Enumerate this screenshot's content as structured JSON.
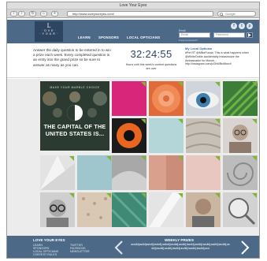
{
  "browser": {
    "window_title": "Love Your Eyes",
    "url": "http://www.loveyoureyes.com/",
    "search_placeholder": "Google",
    "back_glyph": "‹",
    "forward_glyph": "›",
    "reload_glyph": "↻",
    "home_glyph": "⌂",
    "add_glyph": "+"
  },
  "header": {
    "logo_line1": "L",
    "logo_line2": "· O V E ·",
    "logo_line3": "· Y O U R ·",
    "nav": [
      "LEARN",
      "SPONSORS",
      "LOCAL OPTICIANS"
    ],
    "login_email_label": "Email",
    "login_password_label": "Password",
    "email_placeholder": "Email",
    "password_placeholder": "Password",
    "forgot_link": "Forgot password?",
    "social_icons": [
      "facebook-icon",
      "twitter-icon",
      "pinterest-icon"
    ],
    "social_glyphs": [
      "f",
      "t",
      "p"
    ]
  },
  "info": {
    "intro_text": "Answer the daily question to be entered in to win a prize each week. Every completed question is an entry into the grand prize so be sure to answer as many as you can.",
    "timer": "32:24:55",
    "timer_caption": "Hours until this week's contest questions are over",
    "tweet_handle": "My Local Optician",
    "tweet_text": "#Pet RT @MikeFunda: This is what happens when @WhiteOnMe accidentally Instasnooze the Ambassador for Munch... http://instagram.com/p/2bWBnMknct/"
  },
  "feature": {
    "subtitle": "MAKE YOUR MARBLE CHOICE",
    "caption": "THE CAPITAL OF THE UNITED STATES IS..."
  },
  "footer": {
    "brand": "LOVE YOUR EYES",
    "col1": [
      "LEARN",
      "SPONSORS",
      "LOCAL OPTICIANS",
      "CONTEST RULES"
    ],
    "col2": [
      "TWITTER",
      "FACEBOOK",
      "NEWSLETTER"
    ],
    "prizes_title": "WEEKLY PRIZES",
    "prizes_text": "asd;lkfjasdkfjaskdfj;laskdfj;aslkdfj;lasdkfj;asdkfj;lasdkfj;asdkfj;lasdkfj;asdkfj;lasdkfj;asdkfj;lasdkfj;asdkfj;lasdkfj;asdkfj;lasdkfj;lasdkfj;asd"
  },
  "colors": {
    "header_blue": "#4c6a88",
    "logo_navy": "#2d4561",
    "badge_green": "#7fb53b"
  }
}
